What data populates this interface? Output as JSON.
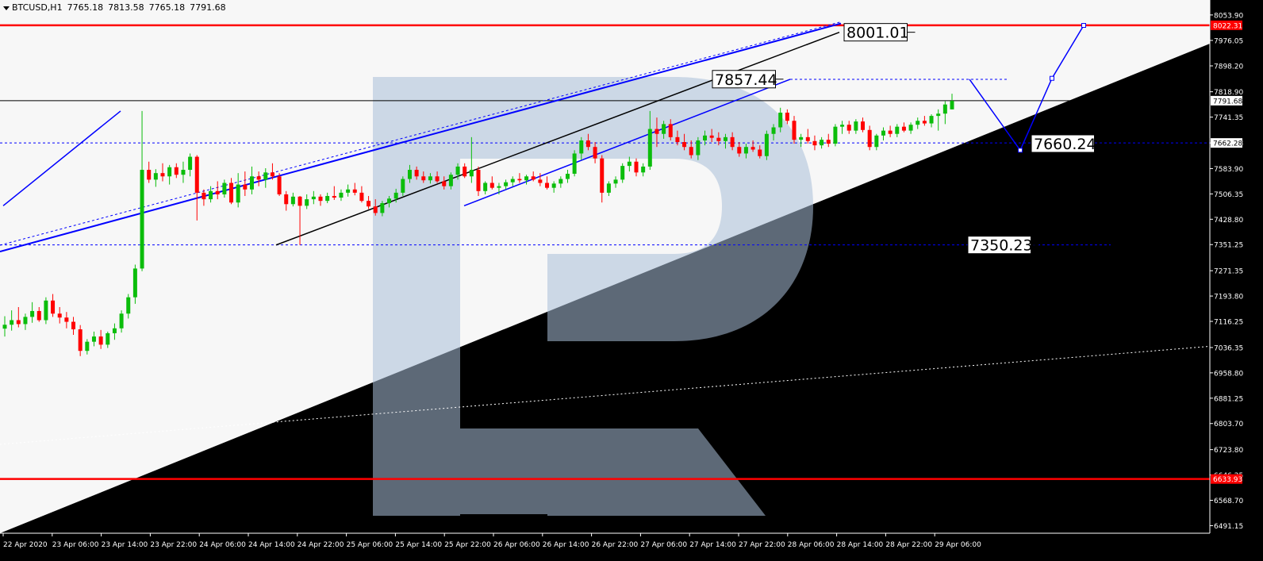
{
  "header": {
    "symbol": "BTCUSD,H1",
    "open": "7765.18",
    "high": "7813.58",
    "low": "7765.18",
    "close": "7791.68"
  },
  "colors": {
    "background": "#f7f7f7",
    "chart_bg": "#000000",
    "bull": "#0bbd0b",
    "bear": "#ff0000",
    "forecast_blue": "#0000ff",
    "level_red": "#ff0000"
  },
  "chart_data": {
    "type": "candlestick",
    "title": "",
    "y_range": [
      6468,
      8090
    ],
    "y_ticks": [
      "8053.90",
      "7976.05",
      "7898.20",
      "7818.90",
      "7741.35",
      "7662.28",
      "7583.90",
      "7506.35",
      "7428.80",
      "7351.25",
      "7271.35",
      "7193.80",
      "7116.25",
      "7036.35",
      "6958.80",
      "6881.25",
      "6803.70",
      "6723.80",
      "6646.25",
      "6568.70",
      "6491.15"
    ],
    "x_ticks": [
      "22 Apr 2020",
      "23 Apr 06:00",
      "23 Apr 14:00",
      "23 Apr 22:00",
      "24 Apr 06:00",
      "24 Apr 14:00",
      "24 Apr 22:00",
      "25 Apr 06:00",
      "25 Apr 14:00",
      "25 Apr 22:00",
      "26 Apr 06:00",
      "26 Apr 14:00",
      "26 Apr 22:00",
      "27 Apr 06:00",
      "27 Apr 14:00",
      "27 Apr 22:00",
      "28 Apr 06:00",
      "28 Apr 14:00",
      "28 Apr 22:00",
      "29 Apr 06:00"
    ],
    "price_badges": [
      "8022.31",
      "7791.68",
      "7662.28",
      "6633.93"
    ],
    "levels": {
      "resistance": 8022.31,
      "support": 6633.93,
      "current": 7791.68,
      "dashed_1": 7662.28,
      "dashed_2": 7350.23
    },
    "annotations": [
      "8001.01",
      "7857.44",
      "7660.24",
      "7350.23"
    ],
    "candles": [
      [
        7094,
        7132,
        7070,
        7106
      ],
      [
        7106,
        7150,
        7088,
        7120
      ],
      [
        7120,
        7160,
        7098,
        7108
      ],
      [
        7108,
        7140,
        7090,
        7130
      ],
      [
        7130,
        7175,
        7112,
        7148
      ],
      [
        7148,
        7160,
        7115,
        7120
      ],
      [
        7120,
        7190,
        7108,
        7180
      ],
      [
        7180,
        7200,
        7130,
        7140
      ],
      [
        7140,
        7160,
        7110,
        7128
      ],
      [
        7128,
        7145,
        7095,
        7115
      ],
      [
        7115,
        7130,
        7075,
        7092
      ],
      [
        7092,
        7105,
        7010,
        7026
      ],
      [
        7026,
        7062,
        7015,
        7054
      ],
      [
        7054,
        7085,
        7040,
        7070
      ],
      [
        7070,
        7090,
        7032,
        7045
      ],
      [
        7045,
        7085,
        7035,
        7080
      ],
      [
        7080,
        7110,
        7060,
        7095
      ],
      [
        7095,
        7150,
        7082,
        7140
      ],
      [
        7140,
        7200,
        7125,
        7190
      ],
      [
        7190,
        7290,
        7170,
        7278
      ],
      [
        7278,
        7760,
        7270,
        7580
      ],
      [
        7580,
        7605,
        7540,
        7550
      ],
      [
        7550,
        7582,
        7528,
        7570
      ],
      [
        7570,
        7600,
        7545,
        7560
      ],
      [
        7560,
        7595,
        7535,
        7588
      ],
      [
        7588,
        7600,
        7555,
        7565
      ],
      [
        7565,
        7605,
        7540,
        7580
      ],
      [
        7580,
        7630,
        7560,
        7620
      ],
      [
        7620,
        7625,
        7425,
        7510
      ],
      [
        7510,
        7520,
        7470,
        7490
      ],
      [
        7490,
        7530,
        7480,
        7515
      ],
      [
        7515,
        7545,
        7490,
        7505
      ],
      [
        7505,
        7550,
        7495,
        7540
      ],
      [
        7540,
        7555,
        7475,
        7480
      ],
      [
        7480,
        7570,
        7465,
        7535
      ],
      [
        7535,
        7575,
        7500,
        7520
      ],
      [
        7520,
        7590,
        7505,
        7560
      ],
      [
        7560,
        7575,
        7530,
        7550
      ],
      [
        7550,
        7585,
        7525,
        7572
      ],
      [
        7572,
        7600,
        7550,
        7560
      ],
      [
        7560,
        7570,
        7500,
        7505
      ],
      [
        7505,
        7515,
        7455,
        7475
      ],
      [
        7475,
        7510,
        7468,
        7498
      ],
      [
        7498,
        7500,
        7350,
        7470
      ],
      [
        7470,
        7505,
        7460,
        7490
      ],
      [
        7490,
        7515,
        7475,
        7498
      ],
      [
        7498,
        7505,
        7470,
        7485
      ],
      [
        7485,
        7510,
        7478,
        7500
      ],
      [
        7500,
        7530,
        7488,
        7495
      ],
      [
        7495,
        7520,
        7485,
        7510
      ],
      [
        7510,
        7535,
        7498,
        7520
      ],
      [
        7520,
        7540,
        7502,
        7510
      ],
      [
        7510,
        7530,
        7480,
        7485
      ],
      [
        7485,
        7500,
        7460,
        7468
      ],
      [
        7468,
        7490,
        7440,
        7448
      ],
      [
        7448,
        7485,
        7438,
        7478
      ],
      [
        7478,
        7500,
        7465,
        7492
      ],
      [
        7492,
        7522,
        7480,
        7510
      ],
      [
        7510,
        7560,
        7500,
        7552
      ],
      [
        7552,
        7595,
        7540,
        7580
      ],
      [
        7580,
        7590,
        7550,
        7560
      ],
      [
        7560,
        7575,
        7540,
        7548
      ],
      [
        7548,
        7570,
        7538,
        7560
      ],
      [
        7560,
        7575,
        7540,
        7545
      ],
      [
        7545,
        7560,
        7520,
        7530
      ],
      [
        7530,
        7572,
        7520,
        7565
      ],
      [
        7565,
        7600,
        7550,
        7590
      ],
      [
        7590,
        7600,
        7555,
        7560
      ],
      [
        7560,
        7680,
        7540,
        7580
      ],
      [
        7580,
        7590,
        7500,
        7515
      ],
      [
        7515,
        7545,
        7505,
        7540
      ],
      [
        7540,
        7560,
        7520,
        7525
      ],
      [
        7525,
        7540,
        7505,
        7530
      ],
      [
        7530,
        7550,
        7520,
        7542
      ],
      [
        7542,
        7560,
        7530,
        7552
      ],
      [
        7552,
        7570,
        7540,
        7548
      ],
      [
        7548,
        7565,
        7535,
        7560
      ],
      [
        7560,
        7575,
        7545,
        7550
      ],
      [
        7550,
        7570,
        7530,
        7540
      ],
      [
        7540,
        7560,
        7520,
        7525
      ],
      [
        7525,
        7545,
        7510,
        7538
      ],
      [
        7538,
        7560,
        7525,
        7552
      ],
      [
        7552,
        7580,
        7540,
        7568
      ],
      [
        7568,
        7640,
        7560,
        7630
      ],
      [
        7630,
        7680,
        7610,
        7670
      ],
      [
        7670,
        7690,
        7640,
        7650
      ],
      [
        7650,
        7665,
        7600,
        7615
      ],
      [
        7615,
        7625,
        7480,
        7510
      ],
      [
        7510,
        7545,
        7500,
        7538
      ],
      [
        7538,
        7560,
        7525,
        7550
      ],
      [
        7550,
        7600,
        7540,
        7592
      ],
      [
        7592,
        7620,
        7575,
        7605
      ],
      [
        7605,
        7615,
        7560,
        7572
      ],
      [
        7572,
        7600,
        7560,
        7590
      ],
      [
        7590,
        7760,
        7580,
        7705
      ],
      [
        7705,
        7740,
        7650,
        7690
      ],
      [
        7690,
        7730,
        7675,
        7720
      ],
      [
        7720,
        7735,
        7670,
        7680
      ],
      [
        7680,
        7700,
        7655,
        7665
      ],
      [
        7665,
        7690,
        7640,
        7650
      ],
      [
        7650,
        7670,
        7615,
        7625
      ],
      [
        7625,
        7680,
        7610,
        7670
      ],
      [
        7670,
        7700,
        7655,
        7685
      ],
      [
        7685,
        7705,
        7665,
        7678
      ],
      [
        7678,
        7695,
        7655,
        7668
      ],
      [
        7668,
        7690,
        7645,
        7680
      ],
      [
        7680,
        7695,
        7640,
        7650
      ],
      [
        7650,
        7665,
        7620,
        7630
      ],
      [
        7630,
        7660,
        7615,
        7650
      ],
      [
        7650,
        7670,
        7635,
        7642
      ],
      [
        7642,
        7655,
        7615,
        7622
      ],
      [
        7622,
        7700,
        7610,
        7690
      ],
      [
        7690,
        7720,
        7670,
        7710
      ],
      [
        7710,
        7770,
        7695,
        7755
      ],
      [
        7755,
        7765,
        7720,
        7730
      ],
      [
        7730,
        7745,
        7660,
        7672
      ],
      [
        7672,
        7690,
        7650,
        7680
      ],
      [
        7680,
        7705,
        7660,
        7668
      ],
      [
        7668,
        7685,
        7640,
        7655
      ],
      [
        7655,
        7680,
        7645,
        7672
      ],
      [
        7672,
        7690,
        7650,
        7660
      ],
      [
        7660,
        7720,
        7652,
        7712
      ],
      [
        7712,
        7730,
        7690,
        7718
      ],
      [
        7718,
        7730,
        7690,
        7700
      ],
      [
        7700,
        7735,
        7690,
        7728
      ],
      [
        7728,
        7740,
        7695,
        7702
      ],
      [
        7702,
        7715,
        7640,
        7650
      ],
      [
        7650,
        7690,
        7640,
        7685
      ],
      [
        7685,
        7710,
        7670,
        7700
      ],
      [
        7700,
        7715,
        7680,
        7690
      ],
      [
        7690,
        7720,
        7680,
        7712
      ],
      [
        7712,
        7725,
        7695,
        7700
      ],
      [
        7700,
        7725,
        7690,
        7718
      ],
      [
        7718,
        7740,
        7705,
        7730
      ],
      [
        7730,
        7745,
        7715,
        7722
      ],
      [
        7722,
        7750,
        7710,
        7745
      ],
      [
        7745,
        7765,
        7700,
        7752
      ],
      [
        7752,
        7790,
        7720,
        7780
      ],
      [
        7765,
        7813,
        7765,
        7791
      ]
    ]
  }
}
